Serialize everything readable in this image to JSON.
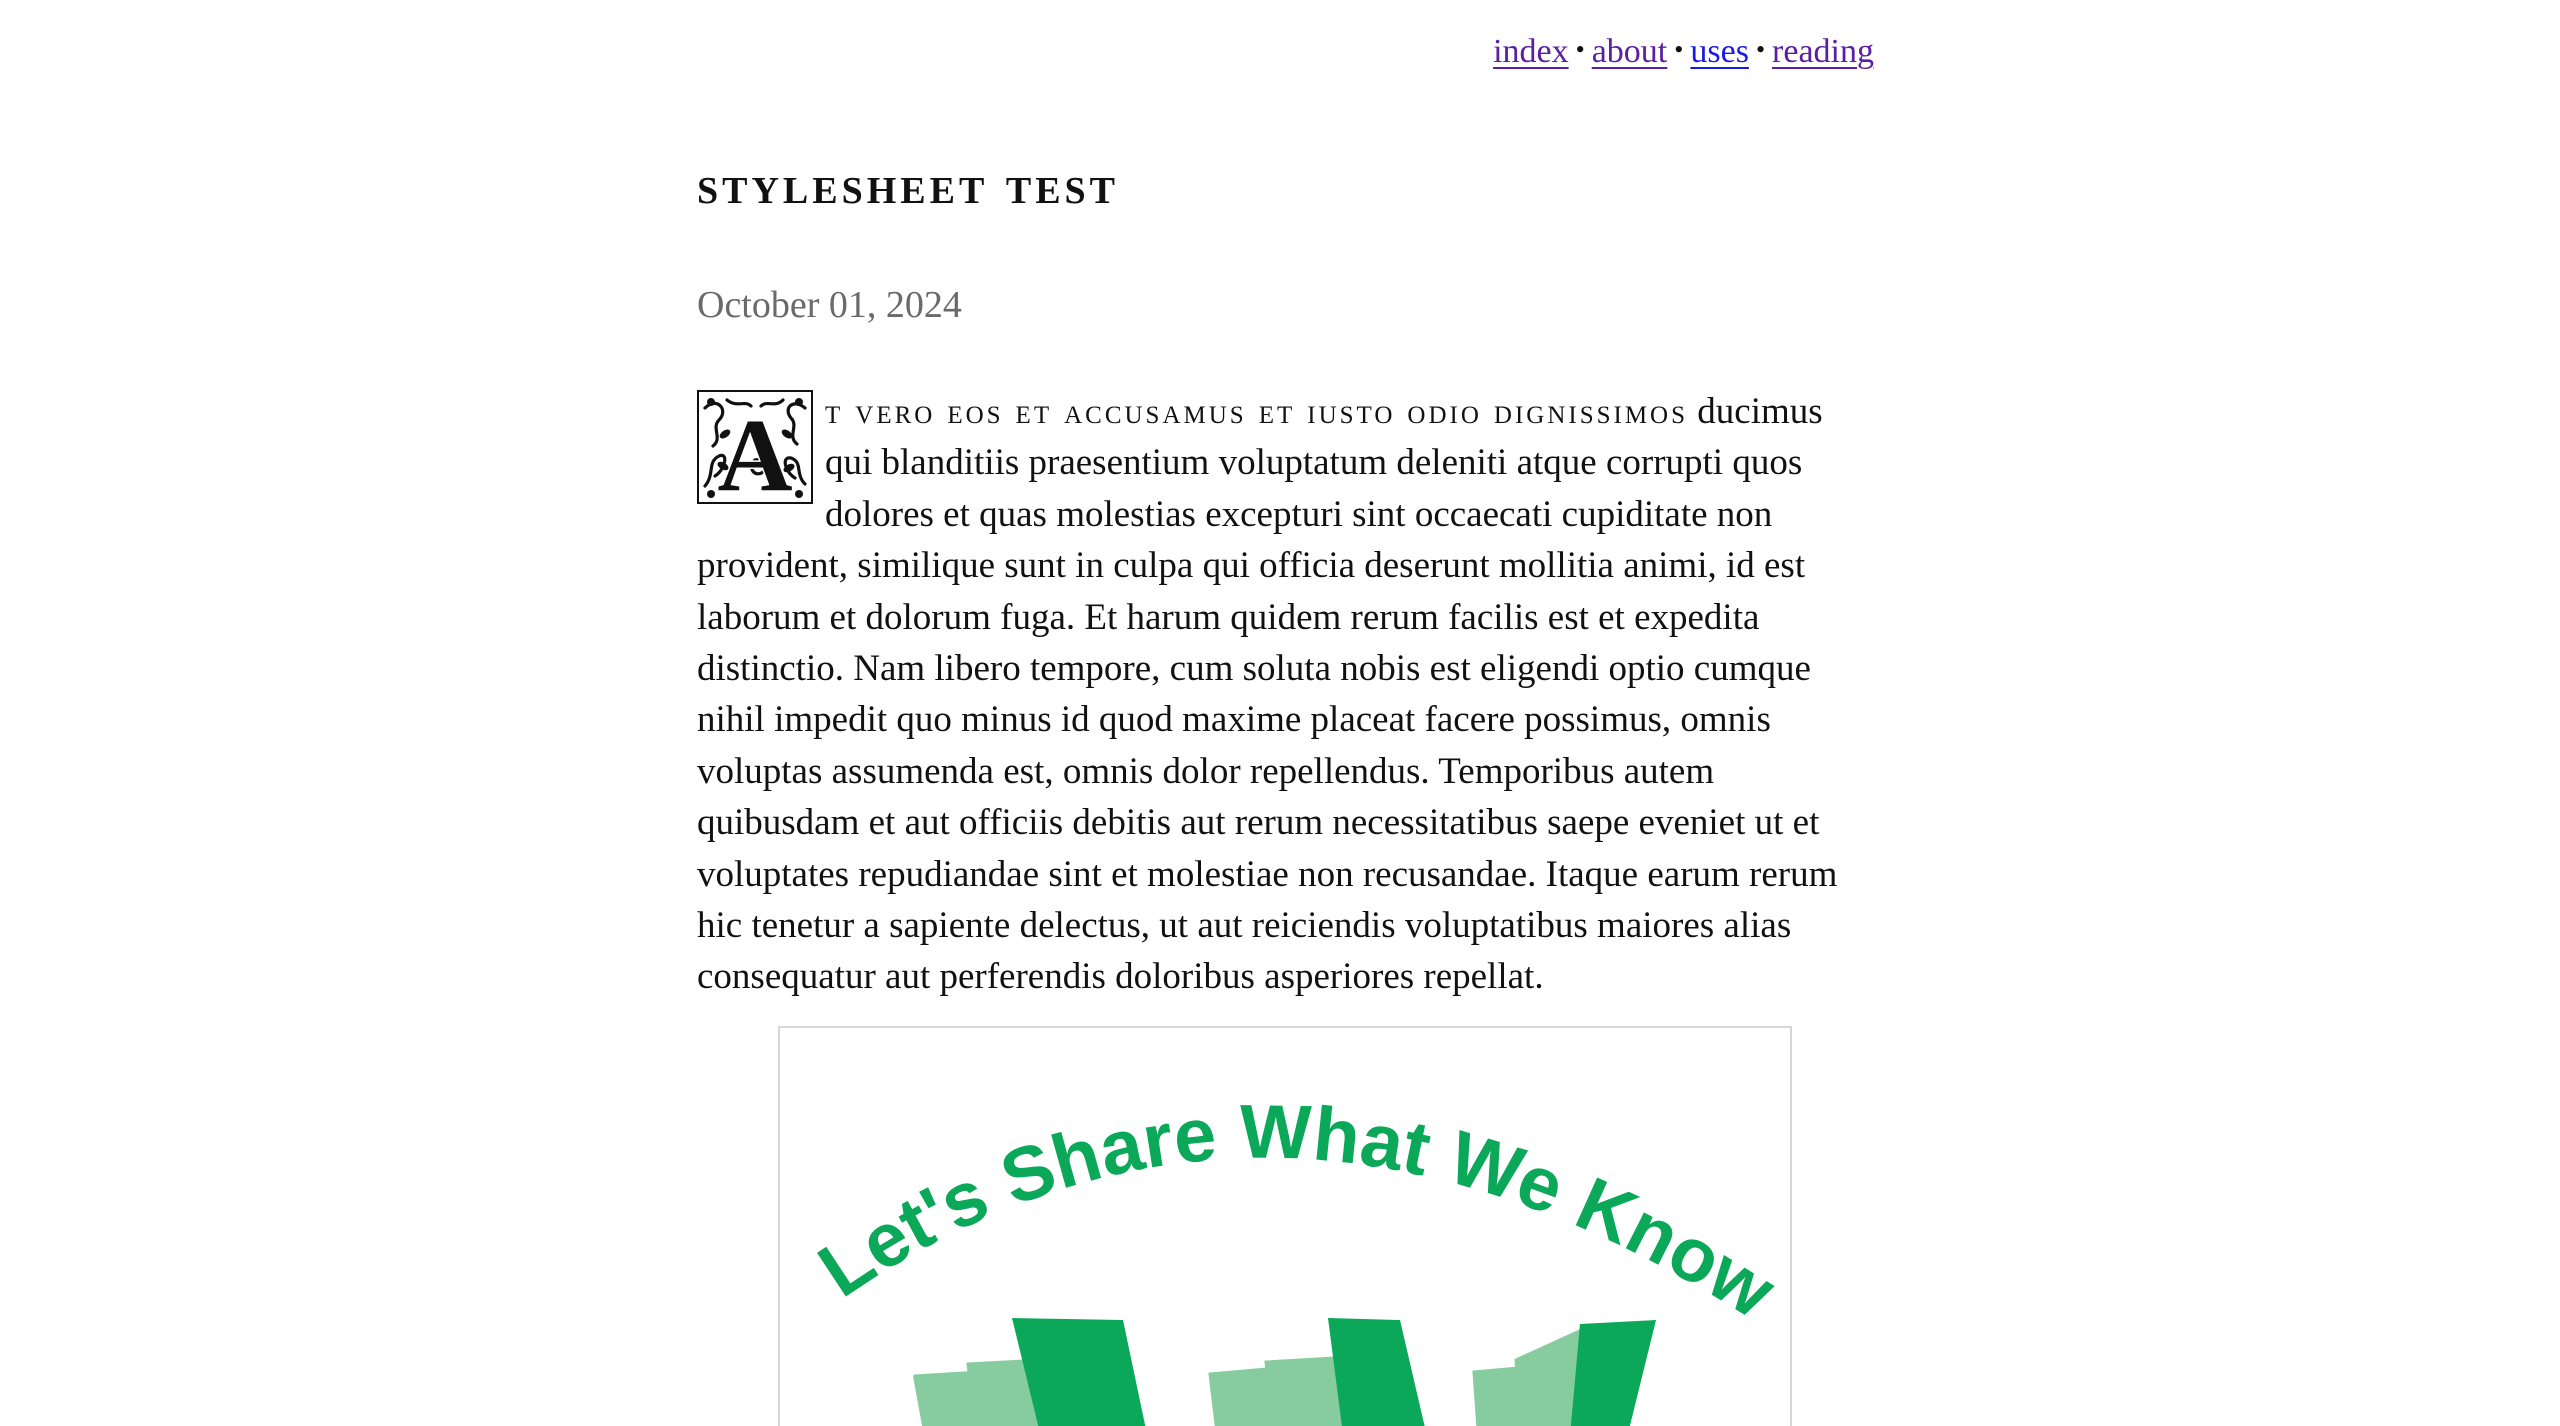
{
  "nav": {
    "items": [
      {
        "label": "index",
        "state": "visited"
      },
      {
        "label": "about",
        "state": "visited"
      },
      {
        "label": "uses",
        "state": "unvisited"
      },
      {
        "label": "reading",
        "state": "visited"
      }
    ],
    "separator": "•"
  },
  "post": {
    "title": "Stylesheet Test",
    "date": "October 01, 2024",
    "dropcap_letter": "A",
    "lead": "t vero eos et accusamus et iusto odio dignissimos",
    "body": "ducimus qui blanditiis praesentium voluptatum deleniti atque corrupti quos dolores et quas molestias excepturi sint occaecati cupiditate non provident, similique sunt in culpa qui officia deserunt mollitia animi, id est laborum et dolorum fuga. Et harum quidem rerum facilis est et expedita distinctio. Nam libero tempore, cum soluta nobis est eligendi optio cumque nihil impedit quo minus id quod maxime placeat facere possimus, omnis voluptas assumenda est, omnis dolor repellendus. Temporibus autem quibusdam et aut officiis debitis aut rerum necessitatibus saepe eveniet ut et voluptates repudiandae sint et molestiae non recusandae. Itaque earum rerum hic tenetur a sapiente delectus, ut aut reiciendis voluptatibus maiores alias consequatur aut perferendis doloribus asperiores repellat."
  },
  "figure": {
    "arc_text": "Let's Share What We Know",
    "icon": "open-books-logo",
    "colors": {
      "green": "#0aa858",
      "light_green": "#86cc9f"
    }
  }
}
